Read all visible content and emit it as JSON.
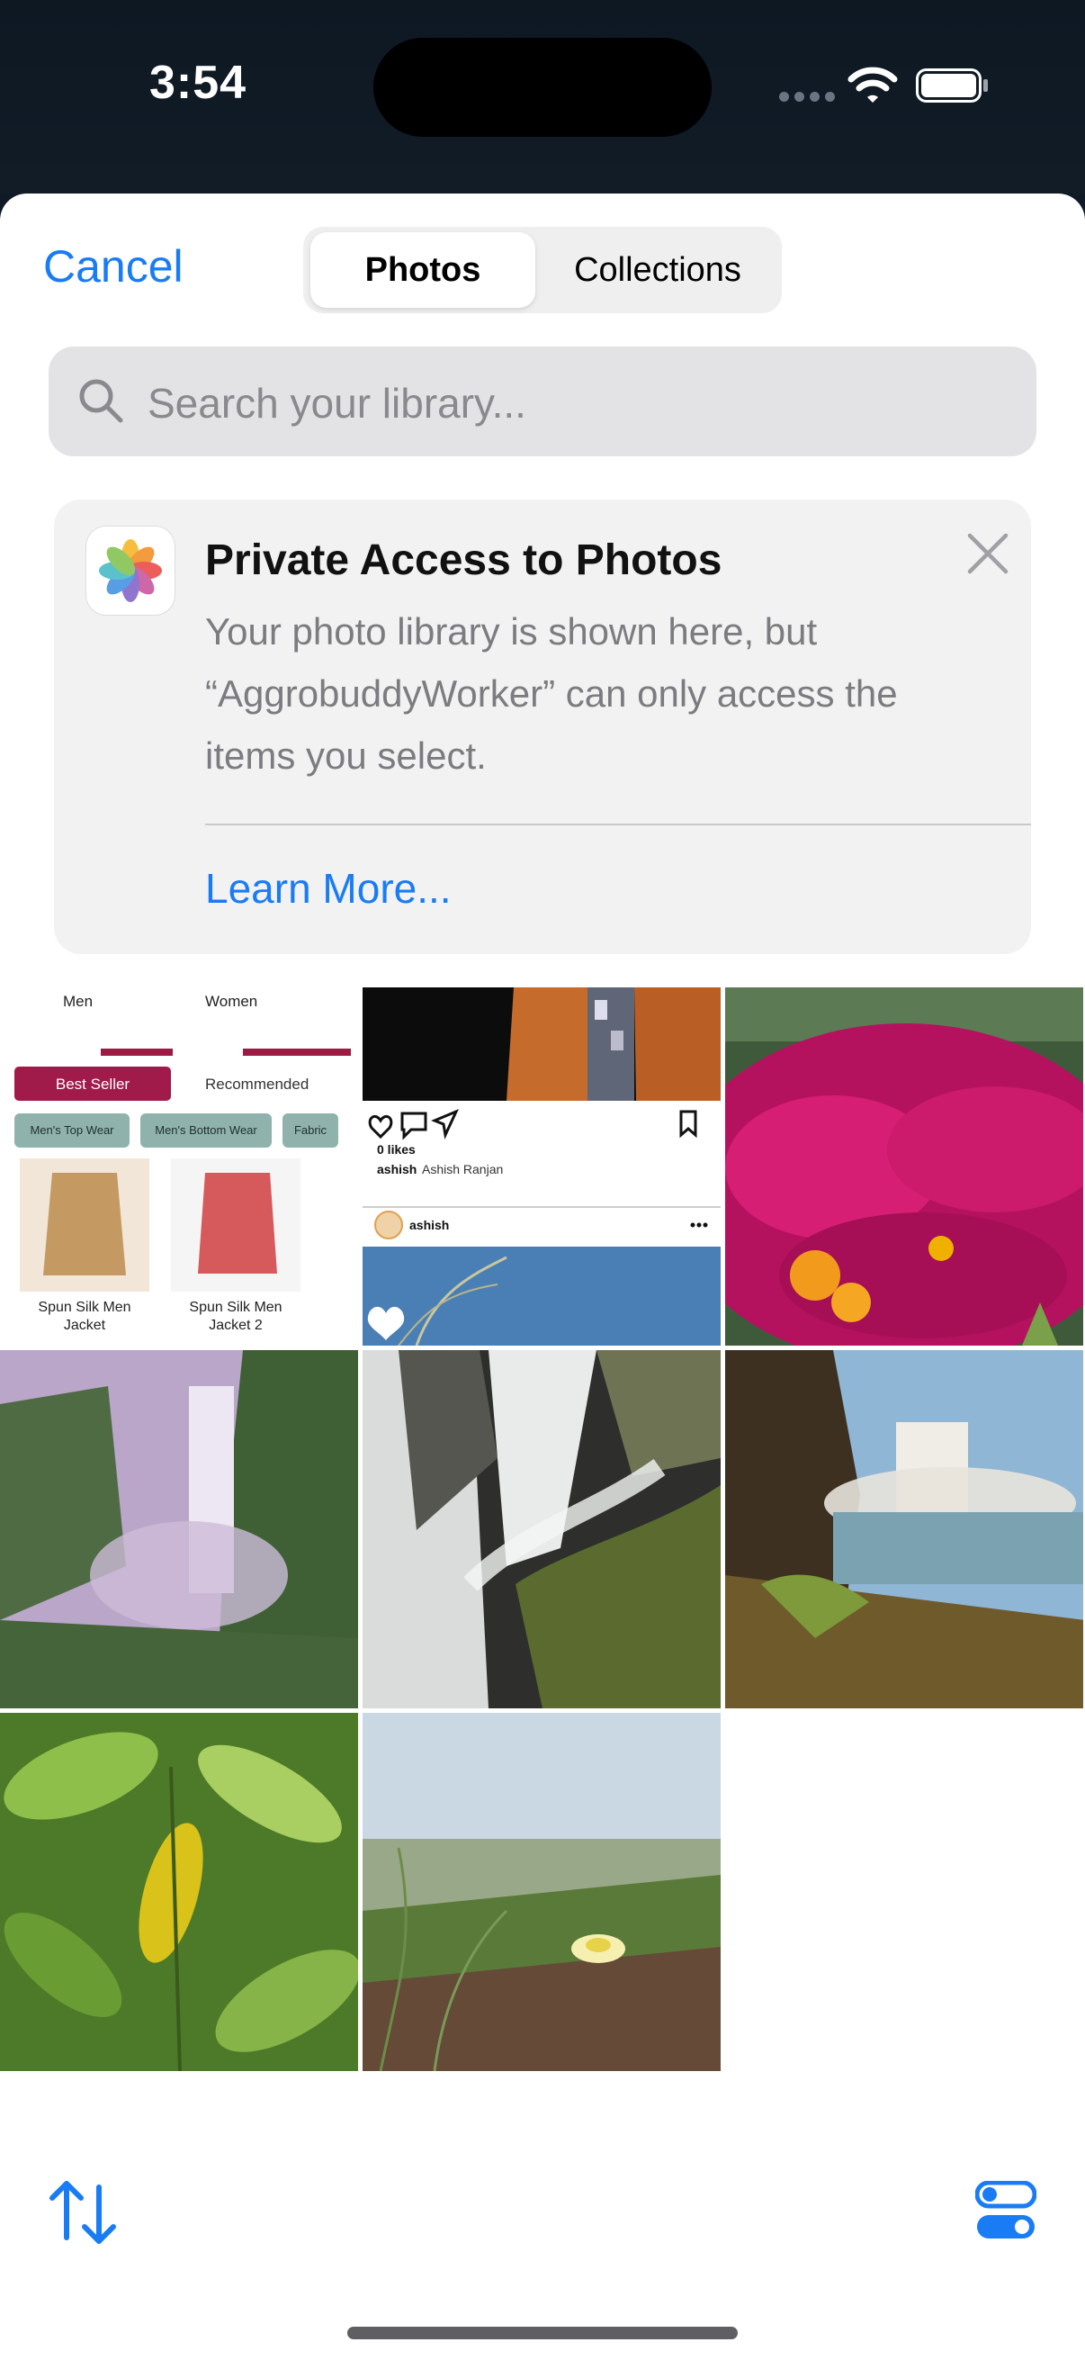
{
  "status_bar": {
    "time": "3:54"
  },
  "header": {
    "cancel_label": "Cancel",
    "tabs": [
      {
        "label": "Photos",
        "selected": true
      },
      {
        "label": "Collections",
        "selected": false
      }
    ]
  },
  "search": {
    "placeholder": "Search your library..."
  },
  "banner": {
    "title": "Private Access to Photos",
    "body": "Your photo library is shown here, but “AggrobuddyWorker” can only access the items you select.",
    "link": "Learn More..."
  },
  "photos": [
    {
      "kind": "app-screenshot",
      "labels": {
        "men": "Men",
        "women": "Women",
        "best_seller": "Best Seller",
        "recommended": "Recommended",
        "chip1": "Men's Top Wear",
        "chip2": "Men's Bottom Wear",
        "chip3": "Fabric",
        "product1": "Spun Silk Men Jacket",
        "product2": "Spun Silk Men Jacket 2"
      }
    },
    {
      "kind": "social-screenshot",
      "labels": {
        "likes": "0 likes",
        "caption_user": "ashish",
        "caption_name": "Ashish Ranjan",
        "post_user": "ashish"
      }
    },
    {
      "kind": "magenta-flowers"
    },
    {
      "kind": "misty-waterfall"
    },
    {
      "kind": "rock-waterfall"
    },
    {
      "kind": "coastal-waterfall"
    },
    {
      "kind": "yellow-leaf"
    },
    {
      "kind": "grass-flower"
    }
  ],
  "toolbar": {
    "sort_icon": "sort-arrows-icon",
    "options_icon": "toggles-icon"
  },
  "colors": {
    "accent": "#1a7cf4",
    "best_seller": "#a01a4a",
    "chip": "#8fb2ad"
  }
}
